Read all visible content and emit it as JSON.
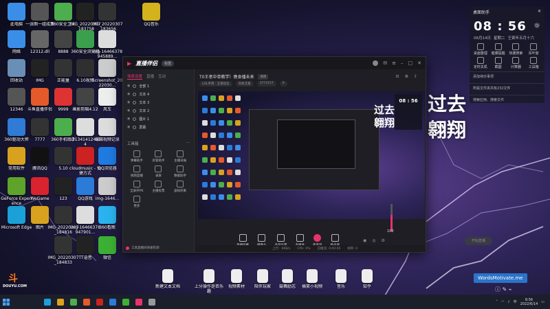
{
  "colors": {
    "accent": "#e7336b",
    "toast": "#2b74c9",
    "taskbar": "#1b1f2b"
  },
  "desktop": {
    "icons": [
      {
        "label": "此电脑",
        "color": "#3b8ee8"
      },
      {
        "label": "一张图一组成集",
        "color": "#555"
      },
      {
        "label": "360安全卫士",
        "color": "#4cae4c"
      },
      {
        "label": "IMG_20220307_183758",
        "color": "#222"
      },
      {
        "label": "IMG_20220307_183656",
        "color": "#333"
      },
      {
        "label": "QQ音乐",
        "color": "#d2b21d"
      },
      {
        "label": "网络",
        "color": "#3b8ee8"
      },
      {
        "label": "12312.dll",
        "color": "#666"
      },
      {
        "label": "8888",
        "color": "#444"
      },
      {
        "label": "360安全浏览器",
        "color": "#3aa04d"
      },
      {
        "label": "img-16466378945889...",
        "color": "#ddd"
      },
      {
        "label": "回收站",
        "color": "#6a8fb6"
      },
      {
        "label": "IMG",
        "color": "#222"
      },
      {
        "label": "正能量",
        "color": "#333"
      },
      {
        "label": "6.10视频",
        "color": "#2f2f2f"
      },
      {
        "label": "Screenshot_2022030...",
        "color": "#ccc"
      },
      {
        "label": "12346",
        "color": "#555"
      },
      {
        "label": "斗鱼直播伴侣",
        "color": "#e55a2a"
      },
      {
        "label": "9999",
        "color": "#d33"
      },
      {
        "label": "画影剪辑4.12",
        "color": "#444"
      },
      {
        "label": "风车",
        "color": "#eee"
      },
      {
        "label": "360驱动大师",
        "color": "#2f7bd5"
      },
      {
        "label": "7777",
        "color": "#333"
      },
      {
        "label": "360手机助手",
        "color": "#4cae4c"
      },
      {
        "label": "1213414124124",
        "color": "#ddd"
      },
      {
        "label": "编辑视频记录",
        "color": "#ddd"
      },
      {
        "label": "常用软件",
        "color": "#d8a21f"
      },
      {
        "label": "腾讯QQ",
        "color": "#111"
      },
      {
        "label": "5.10",
        "color": "#333"
      },
      {
        "label": "cloudmusic - 快捷方式",
        "color": "#c22"
      },
      {
        "label": "QQ浏览器",
        "color": "#1f7be0"
      },
      {
        "label": "GeForce Experience",
        "color": "#5fa42a"
      },
      {
        "label": "WeGame",
        "color": "#d9232f"
      },
      {
        "label": "123",
        "color": "#222"
      },
      {
        "label": "QQ游戏",
        "color": "#2b7bd8"
      },
      {
        "label": "img-1646...",
        "color": "#ccc"
      },
      {
        "label": "Microsoft Edge",
        "color": "#1ba0d8"
      },
      {
        "label": "图片",
        "color": "#d8a21f"
      },
      {
        "label": "IMG_20220307_184816",
        "color": "#333"
      },
      {
        "label": "img-16466378947901...",
        "color": "#ddd"
      },
      {
        "label": "360看图",
        "color": "#2ab3ee"
      },
      {
        "label": "TT语音",
        "color": "#222"
      },
      {
        "label": "微信",
        "color": "#3cb034"
      },
      {
        "label": "IMG_20220307_184833",
        "color": "#333"
      }
    ],
    "bottom_files": [
      {
        "label": "新建文本文档"
      },
      {
        "label": "上分操作是否乐趣"
      },
      {
        "label": "视频素材"
      },
      {
        "label": "陪伴玩家"
      },
      {
        "label": "鼓舞励志"
      },
      {
        "label": "搞笑小视频"
      },
      {
        "label": "音乐"
      },
      {
        "label": "知乎"
      }
    ],
    "wallpaper_text_1": "过去",
    "wallpaper_text_2": "翱翔"
  },
  "widget": {
    "title": "桌面助手",
    "time": "08 : 56",
    "date": "06月14日",
    "weekday": "星期二",
    "lunar": "壬寅年五月十六",
    "grid": [
      "桌面整理",
      "健康提醒",
      "快捷搜索",
      "百叶窗",
      "定时关机",
      "截图",
      "计算器",
      "工具箱"
    ],
    "row1": "添加待办事项",
    "row2": "所属文件夹共有232文件",
    "row3": "搜索应用、搜索文件"
  },
  "app": {
    "logo": "直播伴侣",
    "badge": "标签",
    "tabs": [
      "场景设置",
      "直播",
      "互动"
    ],
    "scenes": [
      "全部 1",
      "文本 4",
      "文本 3",
      "文本 2",
      "图片 1",
      "屏幕"
    ],
    "tools_title": "工具箱",
    "tools": [
      "弹幕助手",
      "房管助手",
      "主播日报",
      "视频直播",
      "录屏",
      "数据助手",
      "全屏开PK",
      "主播投票",
      "虚拟形象",
      "更多"
    ],
    "footer": "工具直播间快速检测",
    "stream_title": "T0王者中单教学）晚食播未来",
    "stream_tag": "修改",
    "meta": [
      "LOL手游 · 王者段位",
      "白色元素",
      "3773157",
      "0"
    ],
    "controls": [
      "直播屏幕",
      "摄像头",
      "多开设置",
      "多媒体",
      "麦克风",
      "扬声器"
    ],
    "volume_value": "100",
    "volume_fraction": 0.6,
    "live_button": "开始直播",
    "status": [
      "上行：0KB/s",
      "CPU: 0%",
      "已推流: 0:00:00",
      "帧率: 0"
    ]
  },
  "toast": "WordsMotivate.me",
  "douyu": {
    "mark": "斗",
    "label": "DOUYU.COM"
  },
  "tray": {
    "time": "8:56",
    "date": "2022/6/14"
  }
}
